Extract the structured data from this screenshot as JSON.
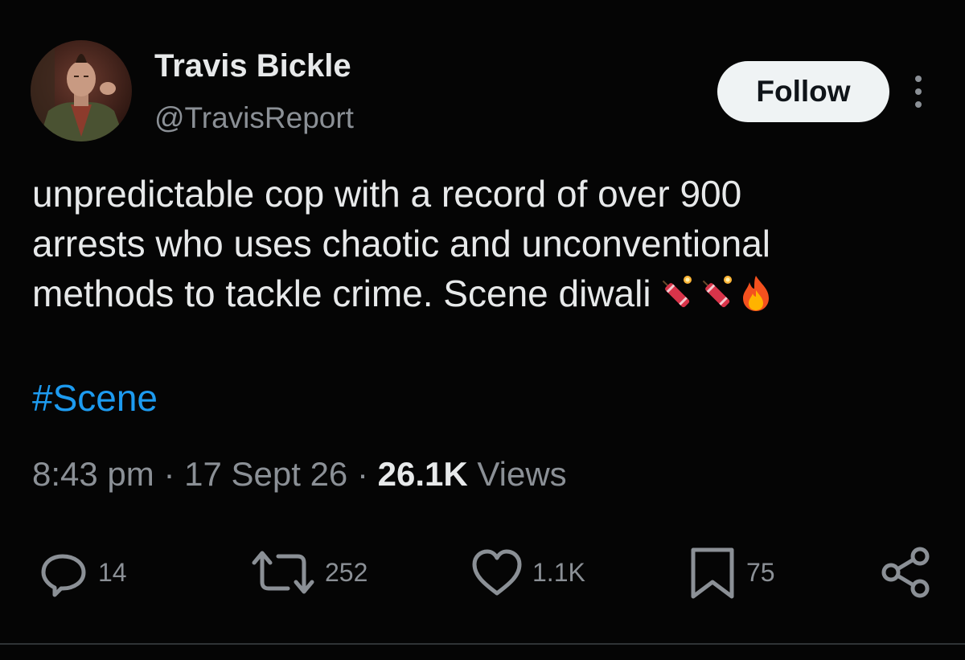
{
  "user": {
    "display_name": "Travis Bickle",
    "handle": "@TravisReport",
    "avatar_icon": "avatar-photo"
  },
  "header": {
    "follow_label": "Follow",
    "more_icon": "more-vertical-icon"
  },
  "tweet": {
    "lines": [
      "unpredictable cop with a record of over 900",
      "arrests who uses chaotic and unconventional",
      "methods to tackle crime. Scene diwali"
    ],
    "emojis": [
      "firecracker",
      "firecracker",
      "fire"
    ],
    "hashtag": "#Scene"
  },
  "meta": {
    "time": "8:43 pm",
    "separator": "·",
    "date": "17 Sept 26",
    "views_count": "26.1K",
    "views_label": "Views"
  },
  "actions": {
    "replies": "14",
    "reposts": "252",
    "likes": "1.1K",
    "bookmarks": "75"
  },
  "colors": {
    "background": "#050505",
    "text": "#e7e9ea",
    "muted": "#8b9096",
    "link": "#1d9bf0",
    "button_bg": "#eff3f4"
  }
}
